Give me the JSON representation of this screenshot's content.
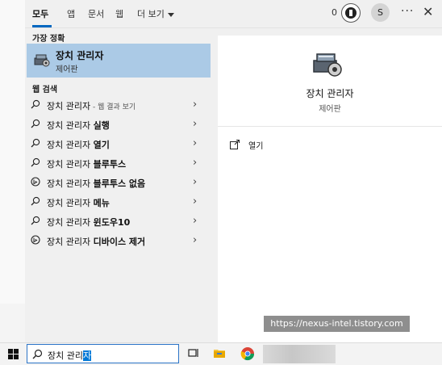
{
  "tabs": [
    {
      "label": "모두",
      "active": true
    },
    {
      "label": "앱"
    },
    {
      "label": "문서"
    },
    {
      "label": "웹"
    },
    {
      "label": "더 보기"
    }
  ],
  "header": {
    "reward_count": "0",
    "avatar_initial": "S",
    "more_glyph": "···",
    "close_glyph": "✕"
  },
  "best_match": {
    "section_label": "가장 정확",
    "title": "장치 관리자",
    "subtitle": "제어판",
    "icon": "device-manager-icon"
  },
  "web": {
    "section_label": "웹 검색",
    "results": [
      {
        "prefix": "장치 관리자",
        "suffix": " - 웹 결과 보기",
        "suffix_style": "small",
        "icon": "search-icon"
      },
      {
        "prefix": "장치 관리자 ",
        "suffix": "실행",
        "icon": "search-icon"
      },
      {
        "prefix": "장치 관리자 ",
        "suffix": "열기",
        "icon": "search-icon"
      },
      {
        "prefix": "장치 관리자 ",
        "suffix": "블루투스",
        "icon": "search-icon"
      },
      {
        "prefix": "장치 관리자 ",
        "suffix": "블루투스 없음",
        "icon": "bing-icon"
      },
      {
        "prefix": "장치 관리자 ",
        "suffix": "메뉴",
        "icon": "search-icon"
      },
      {
        "prefix": "장치 관리자 ",
        "suffix": "윈도우10",
        "icon": "search-icon"
      },
      {
        "prefix": "장치 관리자 ",
        "suffix": "디바이스 제거",
        "icon": "bing-icon"
      }
    ]
  },
  "detail": {
    "title": "장치 관리자",
    "subtitle": "제어판",
    "actions": [
      {
        "label": "열기",
        "icon": "open-icon"
      }
    ]
  },
  "taskbar": {
    "search_typed": "장치 관리",
    "search_selected": "자"
  },
  "watermark": "https://nexus-intel.tistory.com",
  "colors": {
    "accent": "#0067c0",
    "selection": "#abcae6",
    "panel": "#f0f0f0"
  }
}
